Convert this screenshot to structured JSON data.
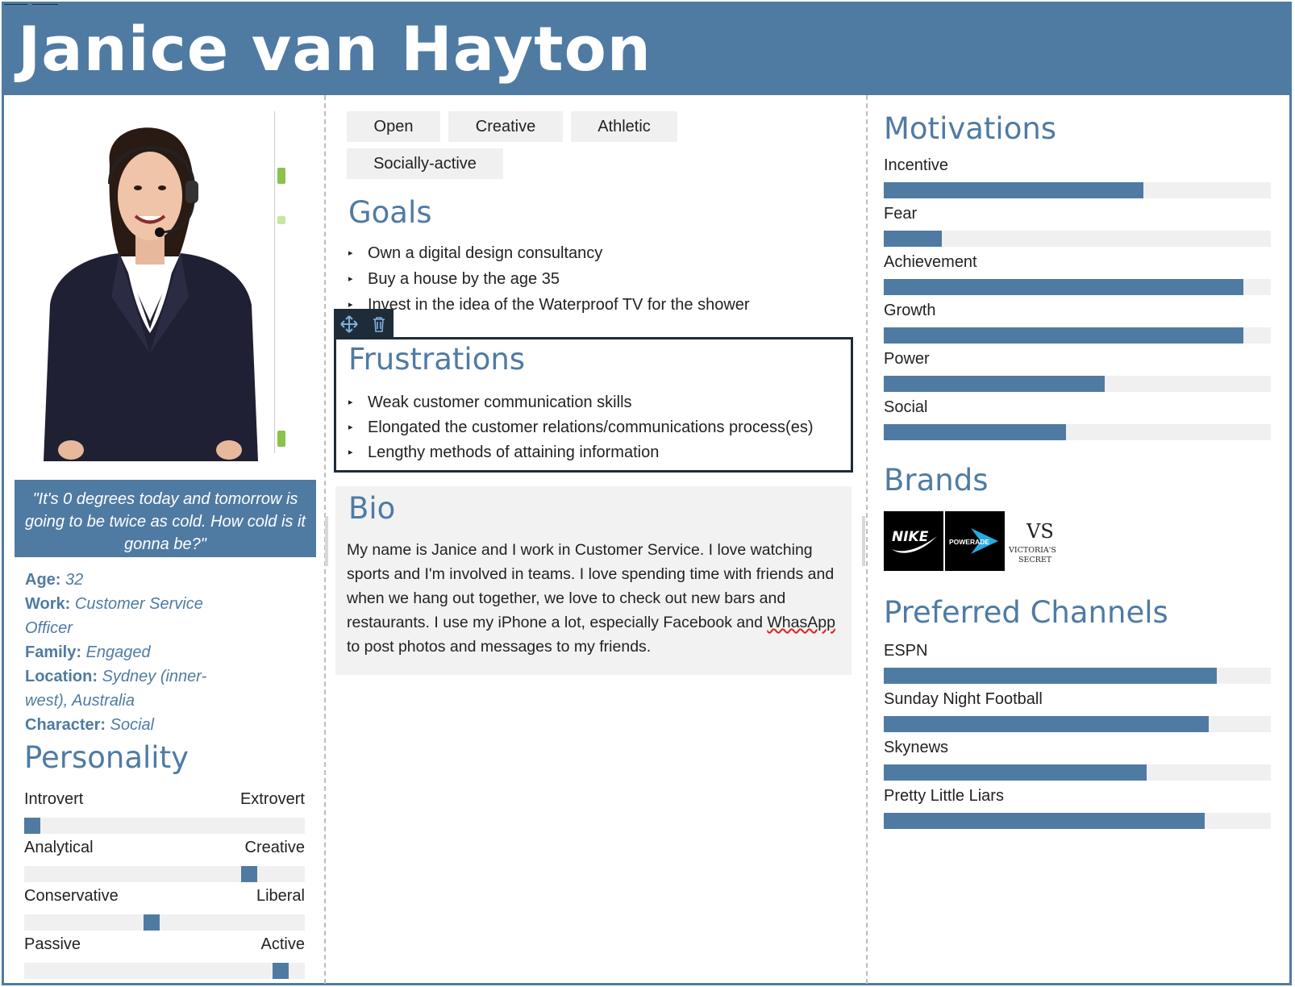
{
  "header": {
    "name": "Janice van Hayton"
  },
  "colors": {
    "accent": "#4f7ba3",
    "dark": "#1e2b38",
    "track": "#f0f0f0"
  },
  "profile": {
    "photo_icon": "person-portrait-icon",
    "quote": "\"It's 0 degrees today and tomorrow is going to be twice as cold. How cold is it gonna be?\"",
    "facts": [
      {
        "label": "Age:",
        "value": "32"
      },
      {
        "label": "Work:",
        "value": "Customer Service Officer"
      },
      {
        "label": "Family:",
        "value": "Engaged"
      },
      {
        "label": "Location:",
        "value": "Sydney (inner-west), Australia"
      },
      {
        "label": "Character:",
        "value": "Social"
      }
    ]
  },
  "personality": {
    "title": "Personality",
    "scales": [
      {
        "left": "Introvert",
        "right": "Extrovert",
        "level": 0.0
      },
      {
        "left": "Analytical",
        "right": "Creative",
        "level": 0.82
      },
      {
        "left": "Conservative",
        "right": "Liberal",
        "level": 0.45
      },
      {
        "left": "Passive",
        "right": "Active",
        "level": 0.94
      }
    ]
  },
  "tags": [
    "Open",
    "Creative",
    "Athletic",
    "Socially-active"
  ],
  "goals": {
    "title": "Goals",
    "items": [
      "Own a digital design consultancy",
      "Buy a house by the age 35",
      "Invest in the idea of the Waterproof TV for the shower"
    ]
  },
  "toolbar": {
    "move_icon": "move-arrows-icon",
    "delete_icon": "trash-icon"
  },
  "frustrations": {
    "title": "Frustrations",
    "items": [
      "Weak customer communication skills",
      "Elongated the customer relations/communications process(es)",
      "Lengthy methods of attaining information"
    ]
  },
  "bio": {
    "title": "Bio",
    "text_before": "My name is Janice and I work in Customer Service. I love watching sports and I'm involved in teams. I love spending time with friends and when we hang out together, we love to check out new bars and restaurants. I use my iPhone a lot, especially Facebook and ",
    "misspelled": "WhasApp",
    "text_after": " to post photos and messages to my friends."
  },
  "motivations": {
    "title": "Motivations",
    "items": [
      {
        "label": "Incentive",
        "level": 0.67
      },
      {
        "label": "Fear",
        "level": 0.15
      },
      {
        "label": "Achievement",
        "level": 0.93
      },
      {
        "label": "Growth",
        "level": 0.93
      },
      {
        "label": "Power",
        "level": 0.57
      },
      {
        "label": "Social",
        "level": 0.47
      }
    ]
  },
  "brands": {
    "title": "Brands",
    "logos": [
      {
        "name": "nike-logo-icon",
        "text": "NIKE"
      },
      {
        "name": "powerade-logo-icon",
        "text": "POWERADE"
      },
      {
        "name": "victorias-secret-logo-icon",
        "text": "VICTORIA'S SECRET"
      }
    ]
  },
  "channels": {
    "title": "Preferred Channels",
    "items": [
      {
        "label": "ESPN",
        "level": 0.86
      },
      {
        "label": "Sunday Night Football",
        "level": 0.84
      },
      {
        "label": "Skynews",
        "level": 0.68
      },
      {
        "label": "Pretty Little Liars",
        "level": 0.83
      }
    ]
  }
}
